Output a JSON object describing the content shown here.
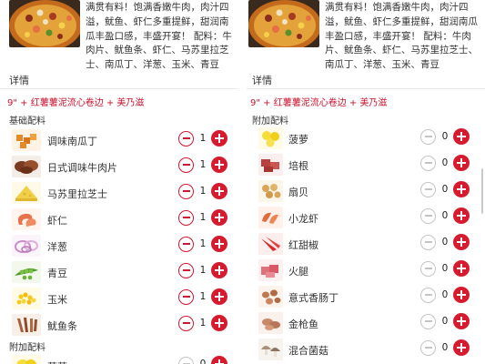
{
  "left": {
    "product": {
      "description": "满贯有料！饱满香嫩牛肉，肉汁四溢，鱿鱼、虾仁多重提鲜，甜润南瓜丰盈口感，丰盛开宴！ 配料：牛肉片、鱿鱼条、虾仁、马苏里拉芝士、南瓜丁、洋葱、玉米、青豆"
    },
    "section_title": "详情",
    "selection": "9\" + 红薯薯泥流心卷边 + 美乃滋",
    "groups": [
      {
        "title": "基础配料"
      },
      {
        "title": "附加配料"
      }
    ],
    "base_items": [
      {
        "name": "调味南瓜丁",
        "qty": "1",
        "icon": "pumpkin-icon"
      },
      {
        "name": "日式调味牛肉片",
        "qty": "1",
        "icon": "beef-icon"
      },
      {
        "name": "马苏里拉芝士",
        "qty": "1",
        "icon": "cheese-icon"
      },
      {
        "name": "虾仁",
        "qty": "1",
        "icon": "shrimp-icon"
      },
      {
        "name": "洋葱",
        "qty": "1",
        "icon": "onion-icon"
      },
      {
        "name": "青豆",
        "qty": "1",
        "icon": "peas-icon"
      },
      {
        "name": "玉米",
        "qty": "1",
        "icon": "corn-icon"
      },
      {
        "name": "鱿鱼条",
        "qty": "1",
        "icon": "squid-icon"
      }
    ],
    "extra_items": [
      {
        "name": "菠萝",
        "qty": "0",
        "icon": "pineapple-icon"
      }
    ]
  },
  "right": {
    "product": {
      "description": "满贯有料！饱满香嫩牛肉，肉汁四溢，鱿鱼、虾仁多重提鲜，甜润南瓜丰盈口感，丰盛开宴！ 配料：牛肉片、鱿鱼条、虾仁、马苏里拉芝士、南瓜丁、洋葱、玉米、青豆"
    },
    "section_title": "详情",
    "selection": "9\" + 红薯薯泥流心卷边 + 美乃滋",
    "group_title": "附加配料",
    "extra_items": [
      {
        "name": "菠萝",
        "qty": "0",
        "icon": "pineapple-icon"
      },
      {
        "name": "培根",
        "qty": "0",
        "icon": "bacon-icon"
      },
      {
        "name": "扇贝",
        "qty": "0",
        "icon": "scallop-icon"
      },
      {
        "name": "小龙虾",
        "qty": "0",
        "icon": "crayfish-icon"
      },
      {
        "name": "红甜椒",
        "qty": "0",
        "icon": "red-pepper-icon"
      },
      {
        "name": "火腿",
        "qty": "0",
        "icon": "ham-icon"
      },
      {
        "name": "意式香肠丁",
        "qty": "0",
        "icon": "sausage-icon"
      },
      {
        "name": "金枪鱼",
        "qty": "0",
        "icon": "tuna-icon"
      },
      {
        "name": "混合菌菇",
        "qty": "0",
        "icon": "mushroom-icon"
      }
    ]
  },
  "colors": {
    "accent": "#d61b2f",
    "accent_text": "#c8132f",
    "disabled": "#c4c4c4",
    "divider": "#e8e8e8"
  }
}
